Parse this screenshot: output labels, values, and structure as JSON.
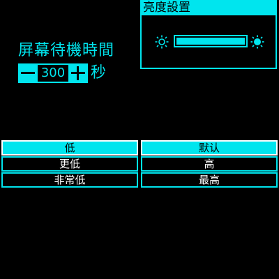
{
  "brightness": {
    "title": "亮度設置",
    "level": 1.0
  },
  "standby": {
    "title": "屏幕待機時間",
    "value": "300",
    "unit": "秒"
  },
  "levels": [
    {
      "label": "低",
      "active": true
    },
    {
      "label": "默认",
      "active": true
    },
    {
      "label": "更低",
      "active": false
    },
    {
      "label": "高",
      "active": false
    },
    {
      "label": "非常低",
      "active": false
    },
    {
      "label": "最高",
      "active": false
    }
  ],
  "colors": {
    "accent": "#00e5ee",
    "background": "#000000",
    "text": "#ffffff"
  },
  "icons": {
    "decrease": "minus-icon",
    "increase": "plus-icon",
    "dim": "sun-outline-icon",
    "bright": "sun-filled-icon"
  }
}
